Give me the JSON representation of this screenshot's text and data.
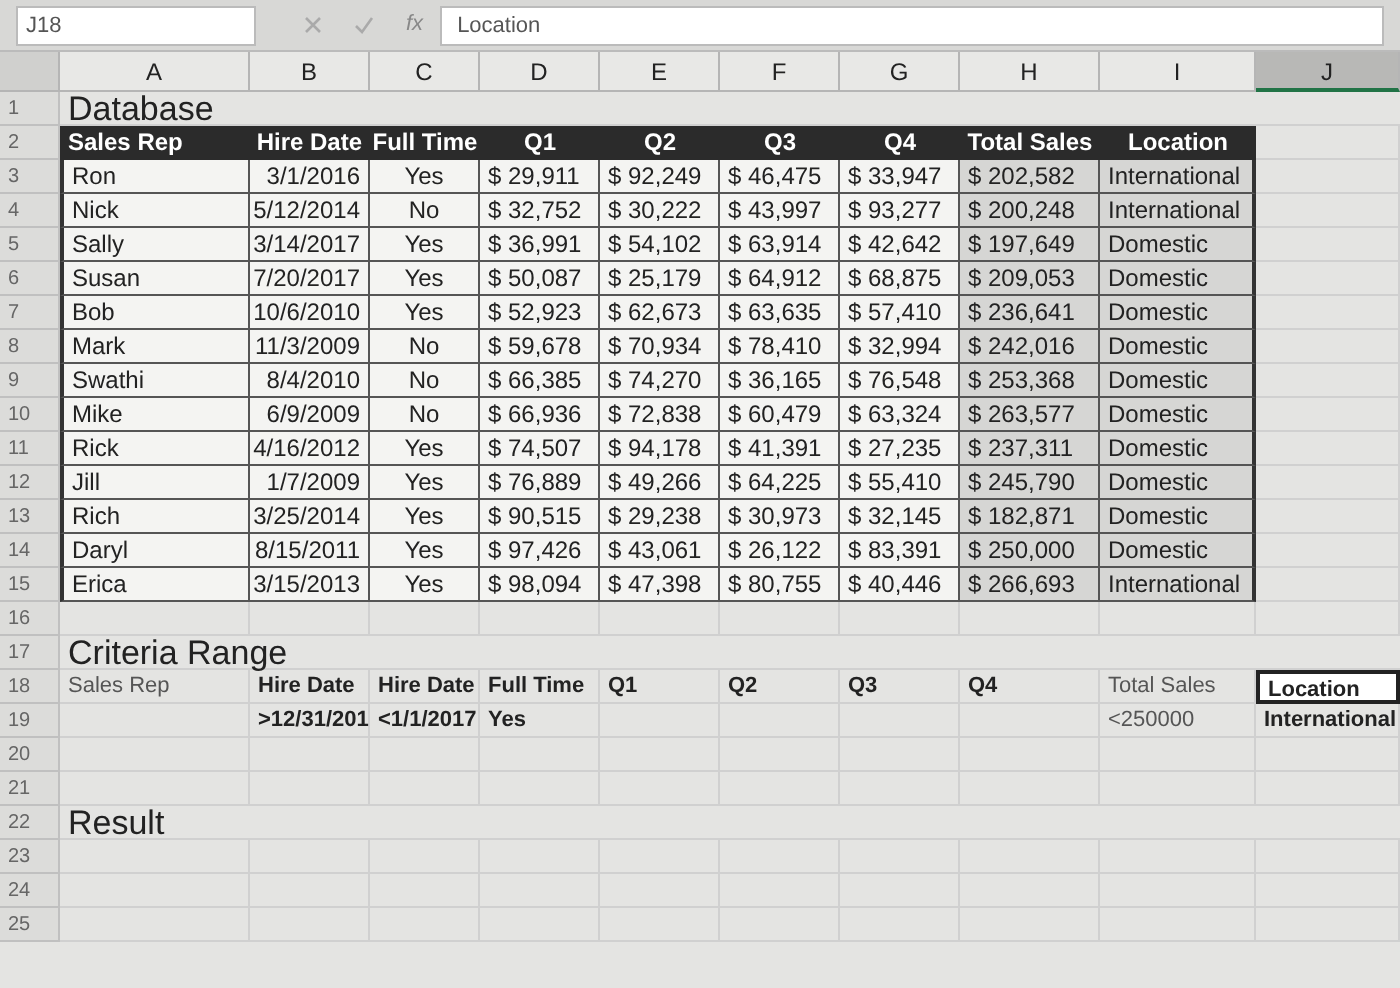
{
  "name_box": "J18",
  "function_label": "fx",
  "formula_bar": "Location",
  "columns": [
    {
      "label": "A",
      "selected": false
    },
    {
      "label": "B",
      "selected": false
    },
    {
      "label": "C",
      "selected": false
    },
    {
      "label": "D",
      "selected": false
    },
    {
      "label": "E",
      "selected": false
    },
    {
      "label": "F",
      "selected": false
    },
    {
      "label": "G",
      "selected": false
    },
    {
      "label": "H",
      "selected": false
    },
    {
      "label": "I",
      "selected": false
    },
    {
      "label": "J",
      "selected": true
    }
  ],
  "rows": [
    {
      "number": "1",
      "kind": "title",
      "text": "Database"
    },
    {
      "number": "2",
      "kind": "header",
      "cells": [
        "Sales Rep",
        "Hire Date",
        "Full Time",
        "Q1",
        "Q2",
        "Q3",
        "Q4",
        "Total Sales",
        "Location"
      ]
    },
    {
      "number": "3",
      "kind": "record",
      "cells": [
        "Ron",
        "3/1/2016",
        "Yes",
        "$ 29,911",
        "$ 92,249",
        "$ 46,475",
        "$ 33,947",
        "$ 202,582",
        "International"
      ]
    },
    {
      "number": "4",
      "kind": "record",
      "cells": [
        "Nick",
        "5/12/2014",
        "No",
        "$ 32,752",
        "$ 30,222",
        "$ 43,997",
        "$ 93,277",
        "$ 200,248",
        "International"
      ]
    },
    {
      "number": "5",
      "kind": "record",
      "cells": [
        "Sally",
        "3/14/2017",
        "Yes",
        "$ 36,991",
        "$ 54,102",
        "$ 63,914",
        "$ 42,642",
        "$ 197,649",
        "Domestic"
      ]
    },
    {
      "number": "6",
      "kind": "record",
      "cells": [
        "Susan",
        "7/20/2017",
        "Yes",
        "$ 50,087",
        "$ 25,179",
        "$ 64,912",
        "$ 68,875",
        "$ 209,053",
        "Domestic"
      ]
    },
    {
      "number": "7",
      "kind": "record",
      "cells": [
        "Bob",
        "10/6/2010",
        "Yes",
        "$ 52,923",
        "$ 62,673",
        "$ 63,635",
        "$ 57,410",
        "$ 236,641",
        "Domestic"
      ]
    },
    {
      "number": "8",
      "kind": "record",
      "cells": [
        "Mark",
        "11/3/2009",
        "No",
        "$ 59,678",
        "$ 70,934",
        "$ 78,410",
        "$ 32,994",
        "$ 242,016",
        "Domestic"
      ]
    },
    {
      "number": "9",
      "kind": "record",
      "cells": [
        "Swathi",
        "8/4/2010",
        "No",
        "$ 66,385",
        "$ 74,270",
        "$ 36,165",
        "$ 76,548",
        "$ 253,368",
        "Domestic"
      ]
    },
    {
      "number": "10",
      "kind": "record",
      "cells": [
        "Mike",
        "6/9/2009",
        "No",
        "$ 66,936",
        "$ 72,838",
        "$ 60,479",
        "$ 63,324",
        "$ 263,577",
        "Domestic"
      ]
    },
    {
      "number": "11",
      "kind": "record",
      "cells": [
        "Rick",
        "4/16/2012",
        "Yes",
        "$ 74,507",
        "$ 94,178",
        "$ 41,391",
        "$ 27,235",
        "$ 237,311",
        "Domestic"
      ]
    },
    {
      "number": "12",
      "kind": "record",
      "cells": [
        "Jill",
        "1/7/2009",
        "Yes",
        "$ 76,889",
        "$ 49,266",
        "$ 64,225",
        "$ 55,410",
        "$ 245,790",
        "Domestic"
      ]
    },
    {
      "number": "13",
      "kind": "record",
      "cells": [
        "Rich",
        "3/25/2014",
        "Yes",
        "$ 90,515",
        "$ 29,238",
        "$ 30,973",
        "$ 32,145",
        "$ 182,871",
        "Domestic"
      ]
    },
    {
      "number": "14",
      "kind": "record",
      "cells": [
        "Daryl",
        "8/15/2011",
        "Yes",
        "$ 97,426",
        "$ 43,061",
        "$ 26,122",
        "$ 83,391",
        "$ 250,000",
        "Domestic"
      ]
    },
    {
      "number": "15",
      "kind": "record",
      "cells": [
        "Erica",
        "3/15/2013",
        "Yes",
        "$ 98,094",
        "$ 47,398",
        "$ 80,755",
        "$ 40,446",
        "$ 266,693",
        "International"
      ]
    },
    {
      "number": "16",
      "kind": "blank"
    },
    {
      "number": "17",
      "kind": "title",
      "text": "Criteria Range"
    },
    {
      "number": "18",
      "kind": "criteria",
      "cells": [
        {
          "text": "Sales Rep",
          "selected": false
        },
        {
          "text": "Hire Date",
          "selected": false
        },
        {
          "text": "Hire Date",
          "selected": false
        },
        {
          "text": "Full Time",
          "selected": false
        },
        {
          "text": "Q1",
          "selected": false
        },
        {
          "text": "Q2",
          "selected": false
        },
        {
          "text": "Q3",
          "selected": false
        },
        {
          "text": "Q4",
          "selected": false
        },
        {
          "text": "Total Sales",
          "selected": false
        },
        {
          "text": "Location",
          "selected": true
        }
      ]
    },
    {
      "number": "19",
      "kind": "criteria",
      "cells": [
        {
          "selected": false
        },
        {
          "text": ">12/31/201",
          "selected": false
        },
        {
          "text": "<1/1/2017",
          "selected": false
        },
        {
          "text": "Yes",
          "selected": false
        },
        {
          "selected": false
        },
        {
          "selected": false
        },
        {
          "selected": false
        },
        {
          "selected": false
        },
        {
          "text": "<250000",
          "selected": false
        },
        {
          "text": "International",
          "selected": false
        }
      ]
    },
    {
      "number": "20",
      "kind": "blank"
    },
    {
      "number": "21",
      "kind": "blank"
    },
    {
      "number": "22",
      "kind": "title",
      "text": "Result"
    },
    {
      "number": "23",
      "kind": "blank"
    },
    {
      "number": "24",
      "kind": "blank"
    },
    {
      "number": "25",
      "kind": "blank"
    }
  ]
}
